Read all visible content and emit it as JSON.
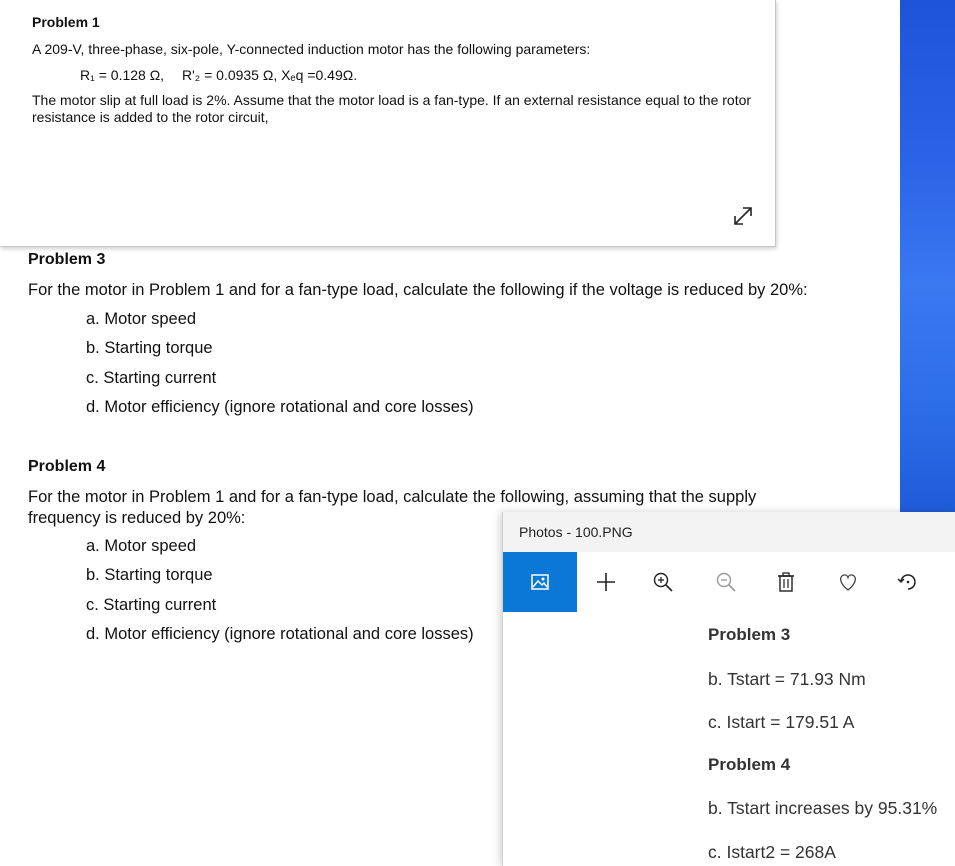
{
  "problem1": {
    "title": "Problem 1",
    "intro": "A 209-V, three-phase, six-pole, Y-connected induction motor has the following parameters:",
    "params": [
      "R₁ = 0.128 Ω,",
      "R'₂ = 0.0935 Ω, Xₑq =0.49Ω."
    ],
    "body": "The motor slip at full load is 2%. Assume that the motor load is a fan-type. If an external resistance equal to the rotor resistance is added to the rotor circuit,"
  },
  "problem3": {
    "title": "Problem 3",
    "text": "For the motor in Problem 1 and for a fan-type load, calculate the following if the voltage is reduced by 20%:",
    "items": [
      "a. Motor speed",
      "b. Starting torque",
      "c. Starting current",
      "d. Motor efficiency (ignore rotational and core losses)"
    ]
  },
  "problem4": {
    "title": "Problem 4",
    "text": "For the motor in Problem 1 and for a fan-type load, calculate the following, assuming that the supply frequency is reduced by 20%:",
    "items": [
      "a. Motor speed",
      "b. Starting torque",
      "c. Starting current",
      "d. Motor efficiency (ignore rotational and core losses)"
    ]
  },
  "photos": {
    "title": "Photos - 100.PNG",
    "content": {
      "heading1": "Problem 3",
      "line1": "b. Tstart = 71.93 Nm",
      "line2": "c. Istart = 179.51 A",
      "heading2": "Problem 4",
      "line3": "b. Tstart increases by 95.31%",
      "line4": "c. Istart2 = 268A"
    }
  },
  "colors": {
    "accent": "#0b78d7",
    "wallpaper": "#2a63e6"
  }
}
